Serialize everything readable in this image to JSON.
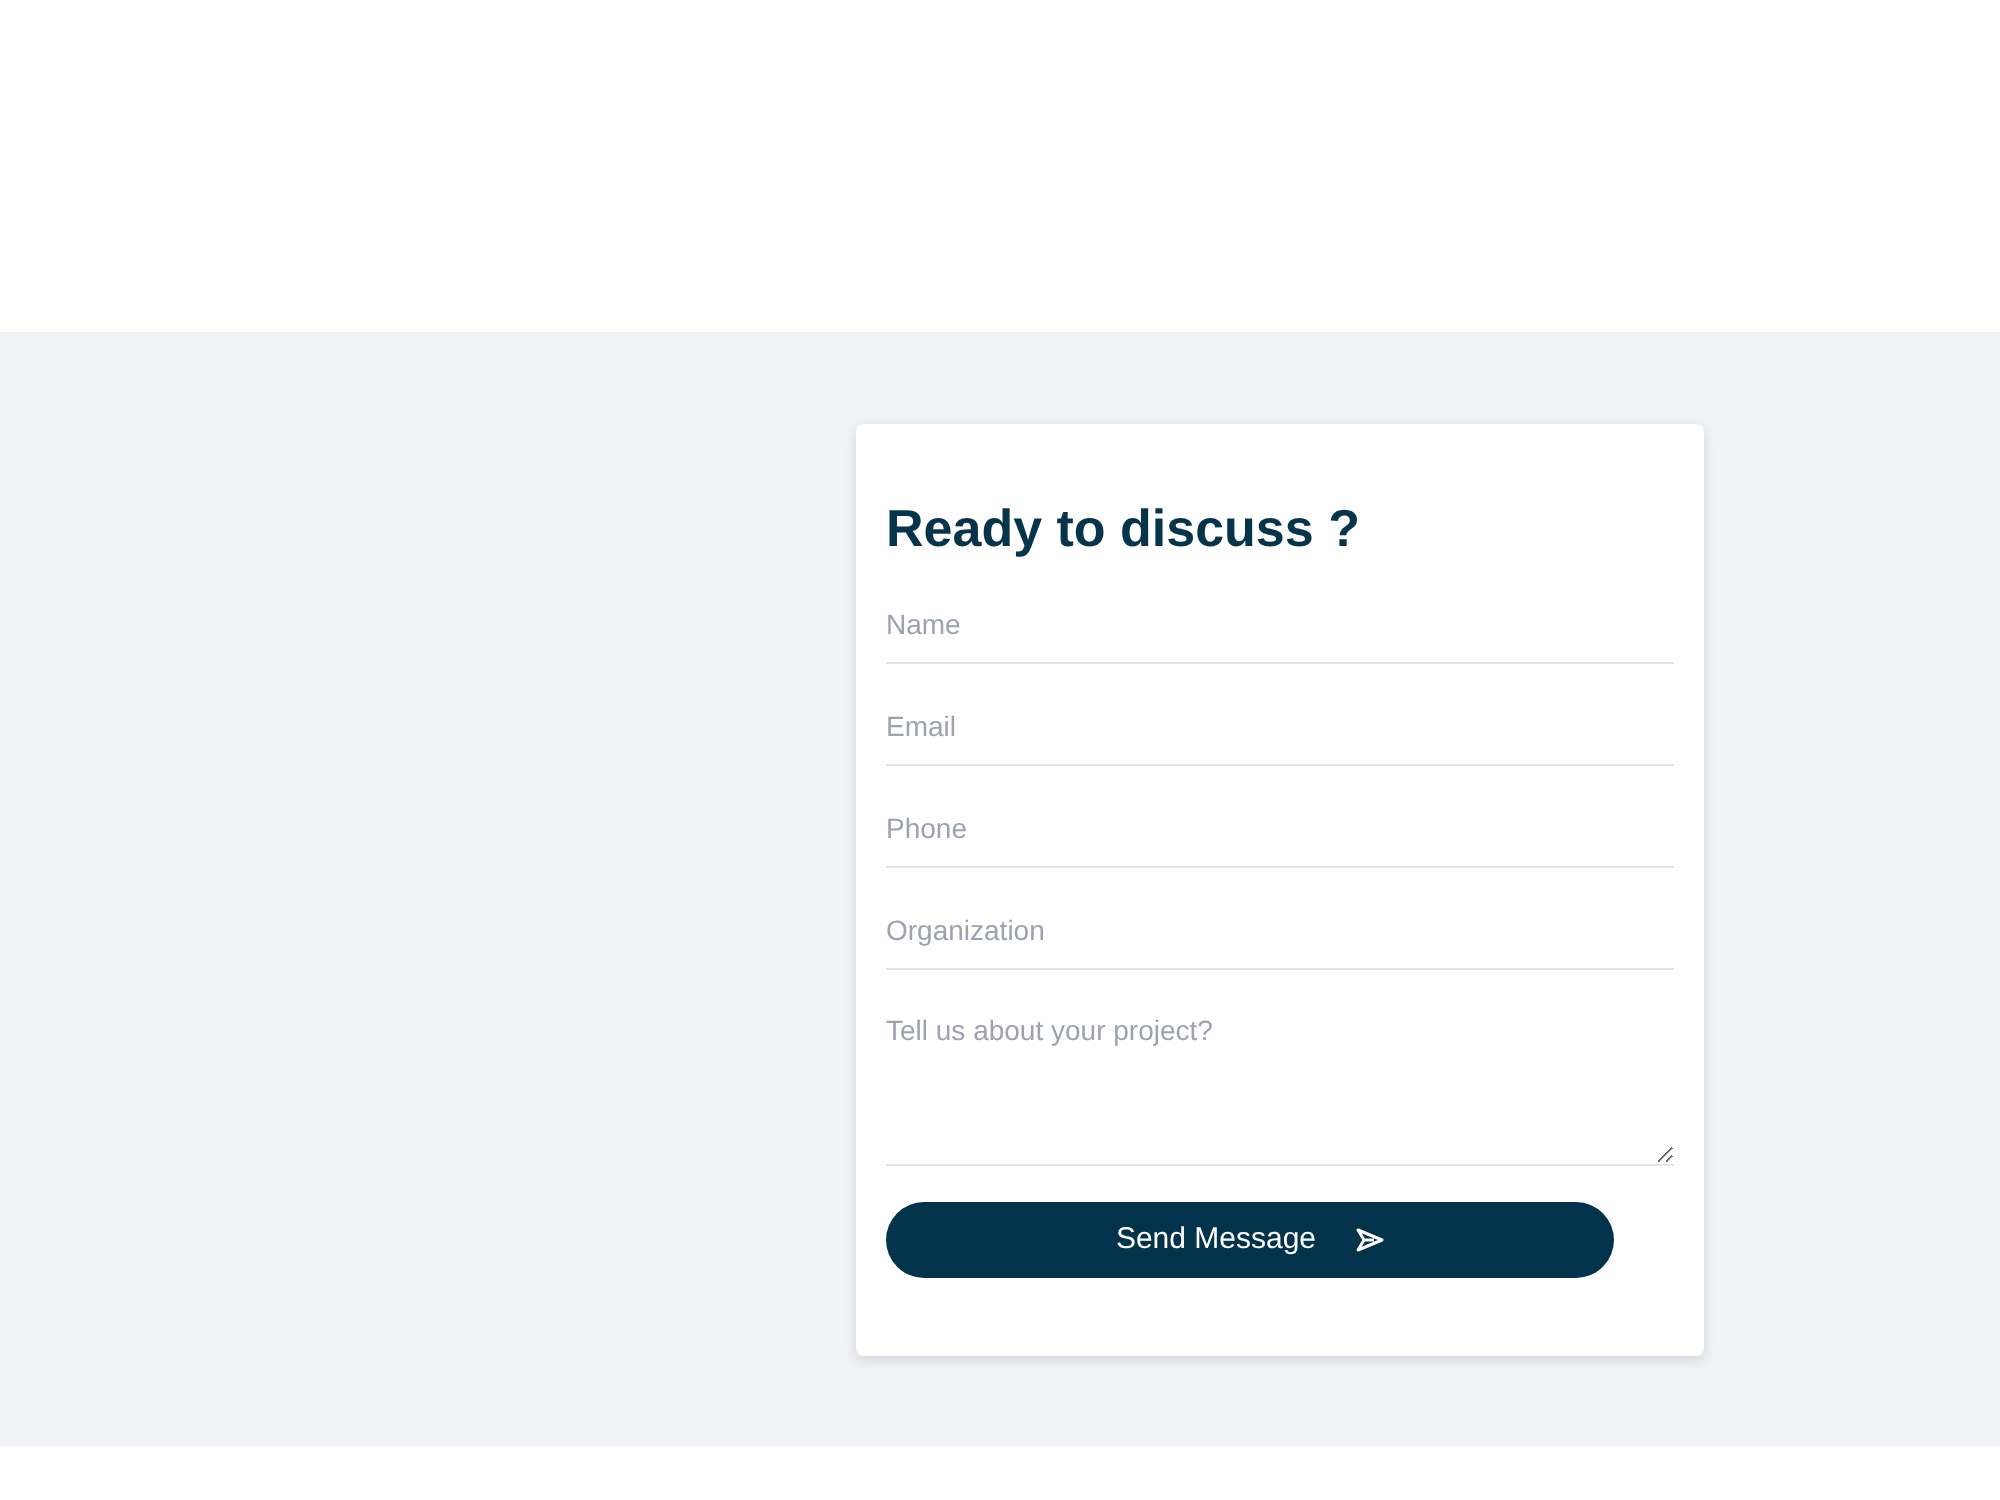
{
  "contact_form": {
    "title": "Ready to discuss ?",
    "fields": [
      {
        "kind": "input",
        "placeholder": "Name"
      },
      {
        "kind": "input",
        "placeholder": "Email"
      },
      {
        "kind": "input",
        "placeholder": "Phone"
      },
      {
        "kind": "input",
        "placeholder": "Organization"
      },
      {
        "kind": "textarea",
        "placeholder": "Tell us about your project?"
      }
    ],
    "submit_button": {
      "label": "Send Message"
    }
  }
}
